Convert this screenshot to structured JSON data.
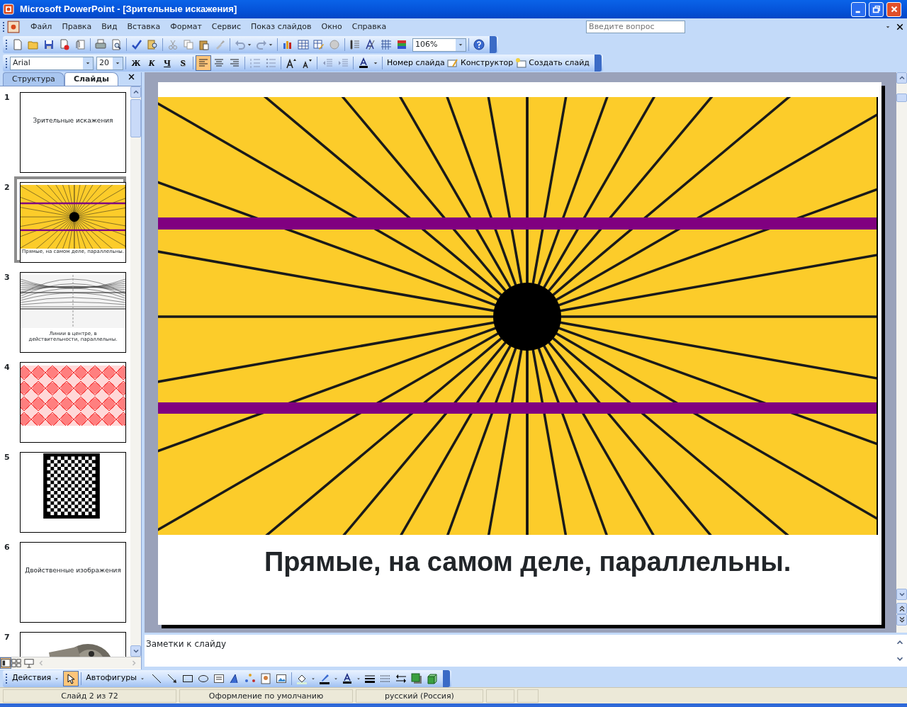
{
  "window": {
    "title": "Microsoft PowerPoint - [Зрительные искажения]"
  },
  "menu": [
    "Файл",
    "Правка",
    "Вид",
    "Вставка",
    "Формат",
    "Сервис",
    "Показ слайдов",
    "Окно",
    "Справка"
  ],
  "help_search": {
    "placeholder": "Введите вопрос"
  },
  "standard_toolbar": {
    "zoom": "106%"
  },
  "formatting_toolbar": {
    "font": "Arial",
    "size": "20",
    "styles": [
      {
        "label": "Ж",
        "kind": "bold"
      },
      {
        "label": "К",
        "kind": "italic"
      },
      {
        "label": "Ч",
        "kind": "underline"
      },
      {
        "label": "S",
        "kind": "shadow"
      }
    ],
    "alignments": [
      {
        "kind": "left",
        "selected": true
      },
      {
        "kind": "center",
        "selected": false
      },
      {
        "kind": "right",
        "selected": false
      }
    ],
    "commands": [
      "Номер слайда",
      "Конструктор",
      "Создать слайд"
    ]
  },
  "pane_tabs": [
    {
      "label": "Структура",
      "selected": false
    },
    {
      "label": "Слайды",
      "selected": true
    }
  ],
  "slides": [
    {
      "number": "1",
      "selected": false,
      "kind": "title",
      "title": "Зрительные искажения"
    },
    {
      "number": "2",
      "selected": true,
      "kind": "rays",
      "caption": "Прямые, на самом деле, параллельны."
    },
    {
      "number": "3",
      "selected": false,
      "kind": "lines",
      "caption": "Линии в центре, в действительности, параллельны."
    },
    {
      "number": "4",
      "selected": false,
      "kind": "pattern"
    },
    {
      "number": "5",
      "selected": false,
      "kind": "checker"
    },
    {
      "number": "6",
      "selected": false,
      "kind": "title",
      "title": "Двойственные изображения"
    },
    {
      "number": "7",
      "selected": false,
      "kind": "picture"
    }
  ],
  "current_slide": {
    "caption": "Прямые, на самом деле, параллельны."
  },
  "notes": {
    "placeholder": "Заметки к слайду"
  },
  "drawing_toolbar": {
    "menus": [
      "Действия",
      "Автофигуры"
    ],
    "select_tool": {
      "selected": true
    }
  },
  "status_bar": [
    "Слайд 2 из 72",
    "Оформление по умолчанию",
    "русский (Россия)"
  ]
}
